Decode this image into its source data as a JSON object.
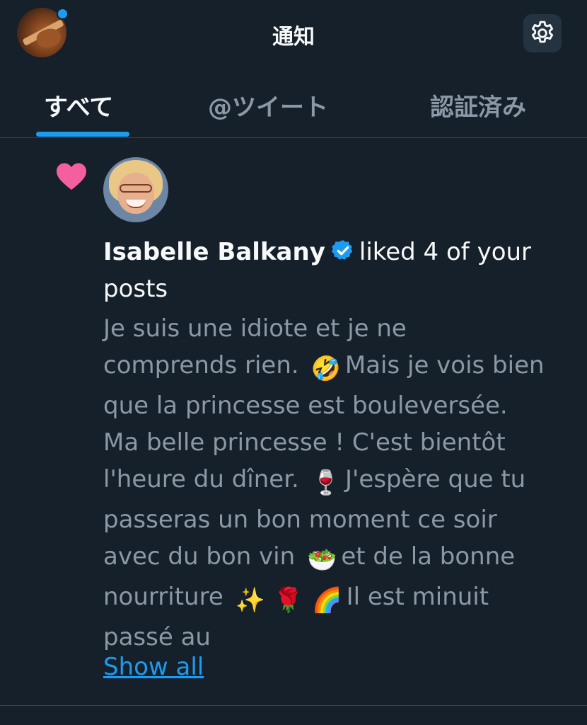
{
  "header": {
    "title": "通知",
    "profile_avatar_icon": "bass-guitar-avatar",
    "settings_icon": "gear-icon"
  },
  "tabs": [
    {
      "label": "すべて",
      "active": true
    },
    {
      "label": "@ツイート",
      "active": false
    },
    {
      "label": "認証済み",
      "active": false
    }
  ],
  "notification": {
    "type_icon": "heart-icon",
    "user_name": "Isabelle Balkany",
    "verified": true,
    "action_text": "liked 4 of your",
    "action_text_2": "posts",
    "tweet_lines": [
      [
        "Je suis une idiote et je ne"
      ],
      [
        "comprends rien.",
        "🤣",
        "Mais je vois bien"
      ],
      [
        "que la princesse est bouleversée."
      ],
      [
        "Ma belle princesse ! C'est bientôt"
      ],
      [
        "l'heure du dîner.",
        "🍷",
        "J'espère que tu"
      ],
      [
        "passeras un bon moment ce soir"
      ],
      [
        "avec du bon vin",
        "🥗",
        "et de la bonne"
      ],
      [
        "nourriture",
        "✨",
        "🌹",
        "🌈",
        "Il est minuit"
      ],
      [
        "passé au"
      ]
    ],
    "show_all_label": "Show all"
  },
  "colors": {
    "background": "#15202b",
    "accent": "#1d9bf0",
    "heart": "#f91880",
    "primary_text": "#f7f9f9",
    "secondary_text": "#8b98a5",
    "divider": "#38444d"
  }
}
